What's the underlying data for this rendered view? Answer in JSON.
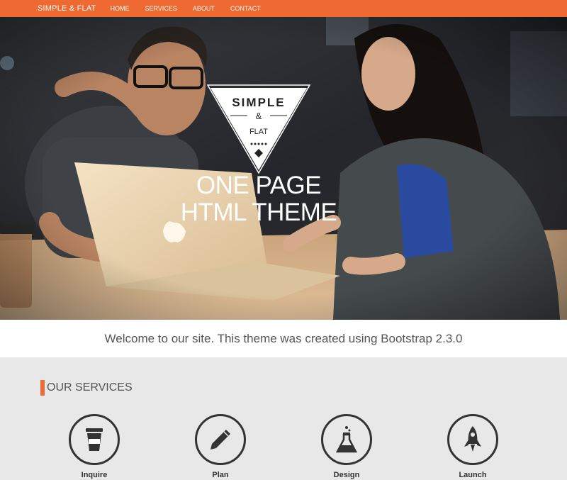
{
  "navbar": {
    "brand": "SIMPLE & FLAT",
    "items": [
      {
        "label": "HOME",
        "active": true
      },
      {
        "label": "SERVICES"
      },
      {
        "label": "ABOUT"
      },
      {
        "label": "CONTACT"
      }
    ]
  },
  "hero": {
    "logo": {
      "line1": "SIMPLE",
      "line2": "&",
      "line3": "FLAT"
    },
    "title_line1": "ONE PAGE",
    "title_line2": "HTML THEME"
  },
  "welcome": {
    "text": "Welcome to our site. This theme was created using Bootstrap 2.3.0"
  },
  "services": {
    "title": "OUR SERVICES",
    "items": [
      {
        "label": "Inquire",
        "icon": "coffee-cup-icon"
      },
      {
        "label": "Plan",
        "icon": "pencil-icon"
      },
      {
        "label": "Design",
        "icon": "flask-icon"
      },
      {
        "label": "Launch",
        "icon": "rocket-icon"
      }
    ]
  },
  "colors": {
    "accent": "#ee6a32",
    "dark": "#333333"
  }
}
